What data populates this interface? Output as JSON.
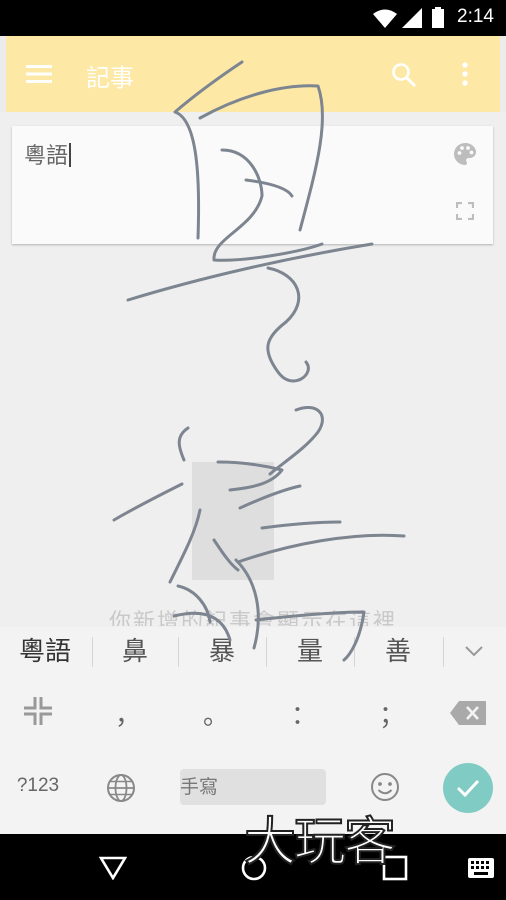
{
  "status_bar": {
    "time": "2:14"
  },
  "app_bar": {
    "title": "記事"
  },
  "note": {
    "text": "粵語"
  },
  "empty_message": "你新增的記事會顯示在這裡",
  "suggestions": [
    "粵語",
    "鼻",
    "暴",
    "量",
    "善"
  ],
  "keyboard": {
    "punctuation": [
      "，",
      "。",
      "：",
      "；"
    ],
    "mode_key": "?123",
    "space_label": "手寫"
  },
  "watermark": "大玩客",
  "colors": {
    "app_bar": "#fde9a5",
    "enter_key": "#80cbc4",
    "handwriting_ink": "#7d8590"
  }
}
